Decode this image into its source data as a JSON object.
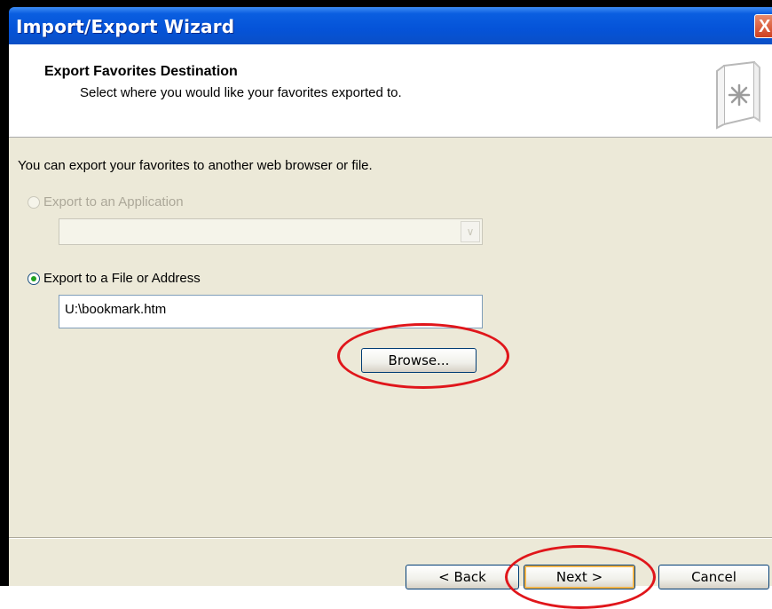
{
  "window": {
    "title": "Import/Export Wizard",
    "close_glyph": "X"
  },
  "header": {
    "title": "Export Favorites Destination",
    "subtitle": "Select where you would like your favorites exported to.",
    "icon": "favorites-book-icon"
  },
  "body": {
    "intro": "You can export your favorites to another web browser or file.",
    "option_application": {
      "label": "Export to an Application",
      "selected": false,
      "enabled": false,
      "dropdown_value": ""
    },
    "option_file": {
      "label": "Export to a File or Address",
      "selected": true,
      "enabled": true,
      "path_value": "U:\\bookmark.htm"
    },
    "browse_label": "Browse..."
  },
  "footer": {
    "back_label": "< Back",
    "next_label": "Next >",
    "cancel_label": "Cancel"
  },
  "colors": {
    "titlebar": "#0553d8",
    "panel": "#ece9d8",
    "annotation": "#e0161b",
    "radio_dot": "#21a121"
  }
}
